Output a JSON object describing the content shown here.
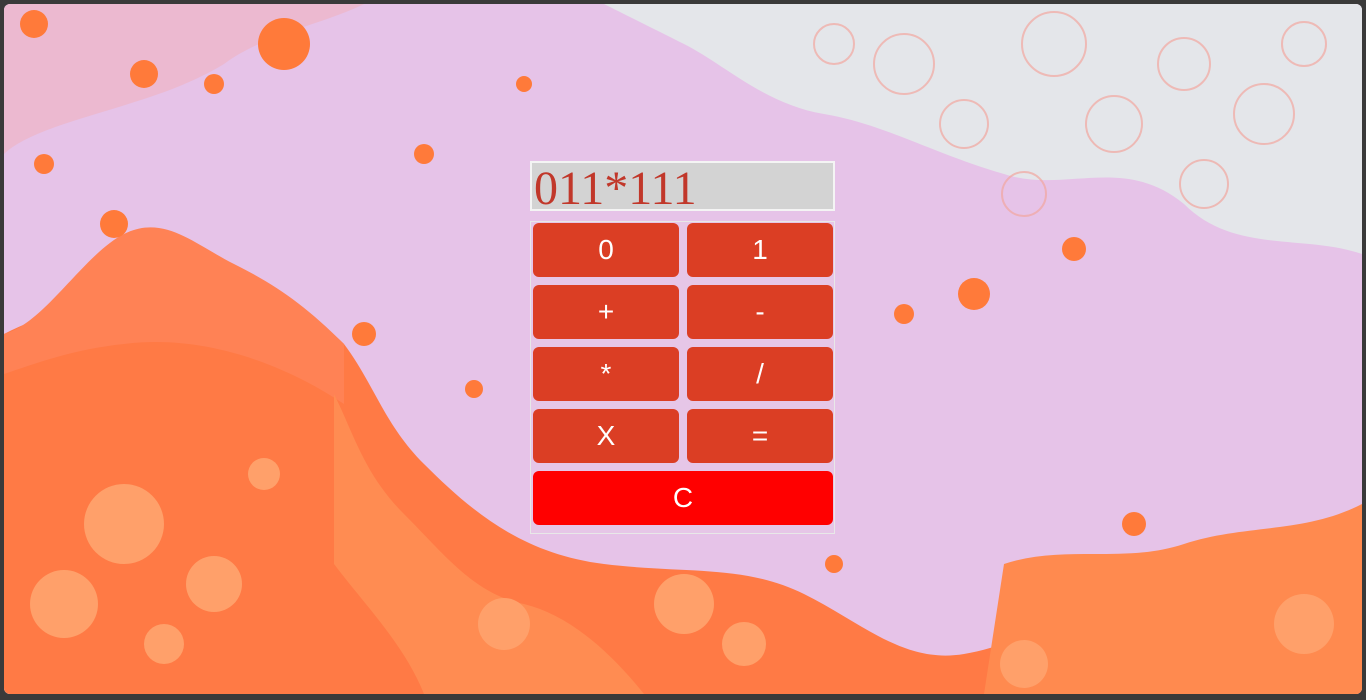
{
  "calculator": {
    "display_value": "011*111",
    "keys": {
      "zero": "0",
      "one": "1",
      "plus": "+",
      "minus": "-",
      "multiply": "*",
      "divide": "/",
      "backspace": "X",
      "equals": "=",
      "clear": "C"
    }
  },
  "colors": {
    "key_background": "#db3e24",
    "clear_background": "#ff0000",
    "display_background": "#d3d3d3",
    "display_text": "#c1372a"
  }
}
